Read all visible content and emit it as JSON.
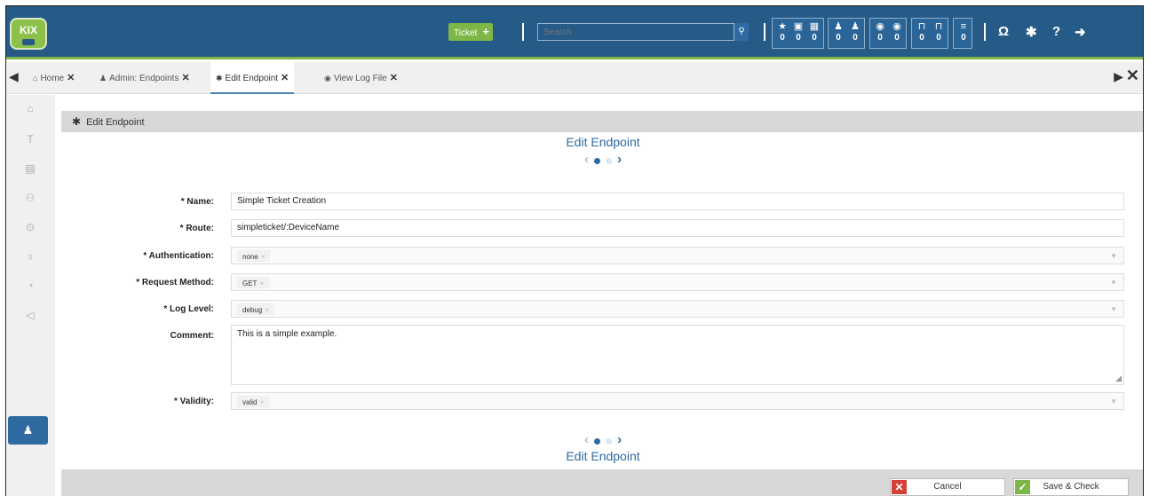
{
  "app": {
    "logo": "KIX"
  },
  "header": {
    "new_ticket_label": "Ticket",
    "search_placeholder": "Search",
    "counters": [
      {
        "icons": [
          "star-icon",
          "calendar-check-icon",
          "calendar-icon"
        ],
        "values": [
          "0",
          "0",
          "0"
        ]
      },
      {
        "icons": [
          "user-new-icon",
          "user-icon"
        ],
        "values": [
          "0",
          "0"
        ]
      },
      {
        "icons": [
          "eye-new-icon",
          "eye-icon"
        ],
        "values": [
          "0",
          "0"
        ]
      },
      {
        "icons": [
          "lock-new-icon",
          "lock-icon"
        ],
        "values": [
          "0",
          "0"
        ]
      },
      {
        "icons": [
          "list-icon"
        ],
        "values": [
          "0"
        ]
      }
    ]
  },
  "tabs": [
    {
      "label": "Home",
      "icon": "home-icon"
    },
    {
      "label": "Admin: Endpoints",
      "icon": "admin-icon"
    },
    {
      "label": "Edit Endpoint",
      "icon": "gear-icon"
    },
    {
      "label": "View Log File",
      "icon": "eye-icon"
    }
  ],
  "panel": {
    "header_title": "Edit Endpoint",
    "form_title": "Edit Endpoint",
    "footer_title": "Edit Endpoint"
  },
  "form": {
    "name": {
      "label": "* Name:",
      "value": "Simple Ticket Creation"
    },
    "route": {
      "label": "* Route:",
      "value": "simpleticket/:DeviceName"
    },
    "authentication": {
      "label": "* Authentication:",
      "value": "none"
    },
    "request_method": {
      "label": "* Request Method:",
      "value": "GET"
    },
    "log_level": {
      "label": "* Log Level:",
      "value": "debug"
    },
    "comment": {
      "label": "Comment:",
      "value": "This is a simple example."
    },
    "validity": {
      "label": "* Validity:",
      "value": "valid"
    }
  },
  "buttons": {
    "cancel": "Cancel",
    "save": "Save & Check"
  },
  "colors": {
    "header": "#265a87",
    "accent": "#7fb648",
    "primary": "#2f6ba0",
    "cancel": "#d6403a"
  }
}
